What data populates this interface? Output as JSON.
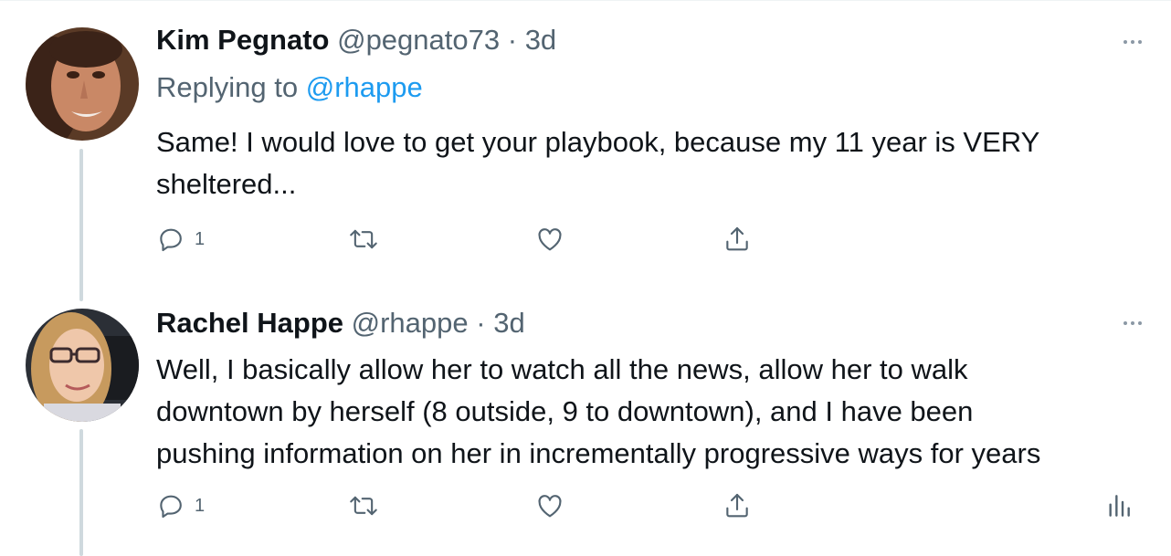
{
  "tweets": [
    {
      "name": "Kim Pegnato",
      "handle": "@pegnato73",
      "separator": "·",
      "time": "3d",
      "replying_label": "Replying to",
      "replying_to": "@rhappe",
      "text_line1": "Same! I would love to get your playbook, because my 11 year is VERY",
      "text_line2": "sheltered...",
      "reply_count": "1",
      "icons": [
        "reply-icon",
        "retweet-icon",
        "like-icon",
        "share-icon",
        "more-icon"
      ]
    },
    {
      "name": "Rachel Happe",
      "handle": "@rhappe",
      "separator": "·",
      "time": "3d",
      "text_line1": "Well, I basically allow her to watch all the news, allow her to walk",
      "text_line2": "downtown by herself (8 outside, 9 to downtown), and I have been",
      "text_line3": "pushing information on her in incrementally progressive ways for years",
      "reply_count": "1",
      "icons": [
        "reply-icon",
        "retweet-icon",
        "like-icon",
        "share-icon",
        "analytics-icon",
        "more-icon"
      ]
    }
  ],
  "colors": {
    "text": "#0f1419",
    "secondary": "#536471",
    "link": "#1d9bf0",
    "thread_line": "#cfd9de"
  }
}
